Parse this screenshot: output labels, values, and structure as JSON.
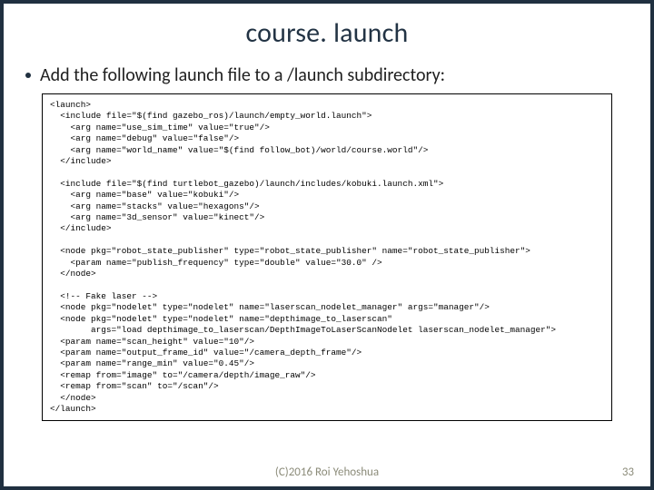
{
  "title": "course. launch",
  "bullet_text": "Add the following launch file to a /launch subdirectory:",
  "code": "<launch>\n  <include file=\"$(find gazebo_ros)/launch/empty_world.launch\">\n    <arg name=\"use_sim_time\" value=\"true\"/>\n    <arg name=\"debug\" value=\"false\"/>\n    <arg name=\"world_name\" value=\"$(find follow_bot)/world/course.world\"/>\n  </include>\n\n  <include file=\"$(find turtlebot_gazebo)/launch/includes/kobuki.launch.xml\">\n    <arg name=\"base\" value=\"kobuki\"/>\n    <arg name=\"stacks\" value=\"hexagons\"/>\n    <arg name=\"3d_sensor\" value=\"kinect\"/>\n  </include>\n\n  <node pkg=\"robot_state_publisher\" type=\"robot_state_publisher\" name=\"robot_state_publisher\">\n    <param name=\"publish_frequency\" type=\"double\" value=\"30.0\" />\n  </node>\n\n  <!-- Fake laser -->\n  <node pkg=\"nodelet\" type=\"nodelet\" name=\"laserscan_nodelet_manager\" args=\"manager\"/>\n  <node pkg=\"nodelet\" type=\"nodelet\" name=\"depthimage_to_laserscan\"\n        args=\"load depthimage_to_laserscan/DepthImageToLaserScanNodelet laserscan_nodelet_manager\">\n  <param name=\"scan_height\" value=\"10\"/>\n  <param name=\"output_frame_id\" value=\"/camera_depth_frame\"/>\n  <param name=\"range_min\" value=\"0.45\"/>\n  <remap from=\"image\" to=\"/camera/depth/image_raw\"/>\n  <remap from=\"scan\" to=\"/scan\"/>\n  </node>\n</launch>",
  "footer": "(C)2016 Roi Yehoshua",
  "page": "33"
}
